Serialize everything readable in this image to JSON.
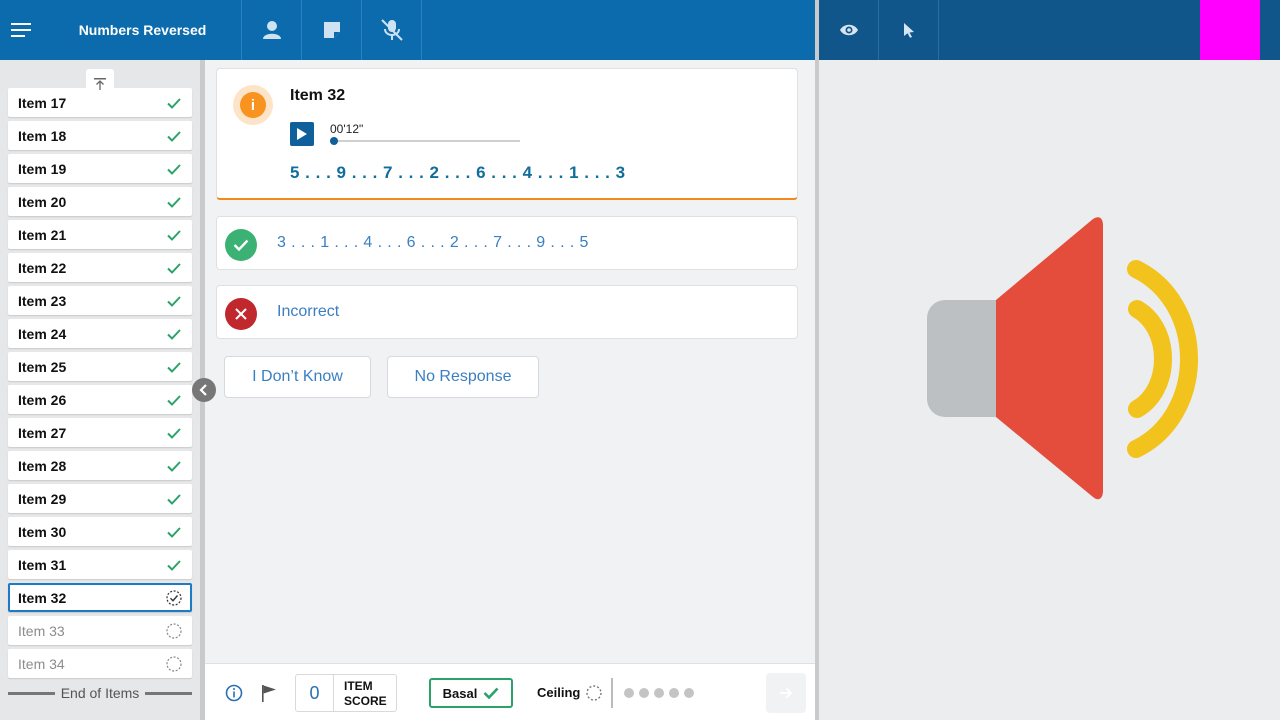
{
  "header": {
    "title": "Numbers Reversed",
    "icons": [
      "menu-icon",
      "user-icon",
      "notes-icon",
      "microphone-off-icon"
    ],
    "right_icons": [
      "eye-icon",
      "pointer-icon"
    ],
    "accent_color": "#ff00ff"
  },
  "sidebar": {
    "items": [
      {
        "label": "Item 17",
        "status": "done"
      },
      {
        "label": "Item 18",
        "status": "done"
      },
      {
        "label": "Item 19",
        "status": "done"
      },
      {
        "label": "Item 20",
        "status": "done"
      },
      {
        "label": "Item 21",
        "status": "done"
      },
      {
        "label": "Item 22",
        "status": "done"
      },
      {
        "label": "Item 23",
        "status": "done"
      },
      {
        "label": "Item 24",
        "status": "done"
      },
      {
        "label": "Item 25",
        "status": "done"
      },
      {
        "label": "Item 26",
        "status": "done"
      },
      {
        "label": "Item 27",
        "status": "done"
      },
      {
        "label": "Item 28",
        "status": "done"
      },
      {
        "label": "Item 29",
        "status": "done"
      },
      {
        "label": "Item 30",
        "status": "done"
      },
      {
        "label": "Item 31",
        "status": "done"
      },
      {
        "label": "Item 32",
        "status": "current"
      },
      {
        "label": "Item 33",
        "status": "pending"
      },
      {
        "label": "Item 34",
        "status": "pending"
      }
    ],
    "end_label": "End of Items"
  },
  "item": {
    "title": "Item 32",
    "timer": "00'12\"",
    "sequence": "5 . . . 9 . . . 7 . . . 2 . . . 6 . . . 4 . . . 1 . . . 3"
  },
  "responses": {
    "correct": "3 . . . 1 . . . 4 . . . 6 . . . 2 . . . 7 . . . 9 . . . 5",
    "incorrect": "Incorrect"
  },
  "buttons": {
    "dont_know": "I Don’t Know",
    "no_response": "No Response"
  },
  "footer": {
    "score_value": "0",
    "score_label_1": "ITEM",
    "score_label_2": "SCORE",
    "basal": "Basal",
    "ceiling": "Ceiling"
  }
}
